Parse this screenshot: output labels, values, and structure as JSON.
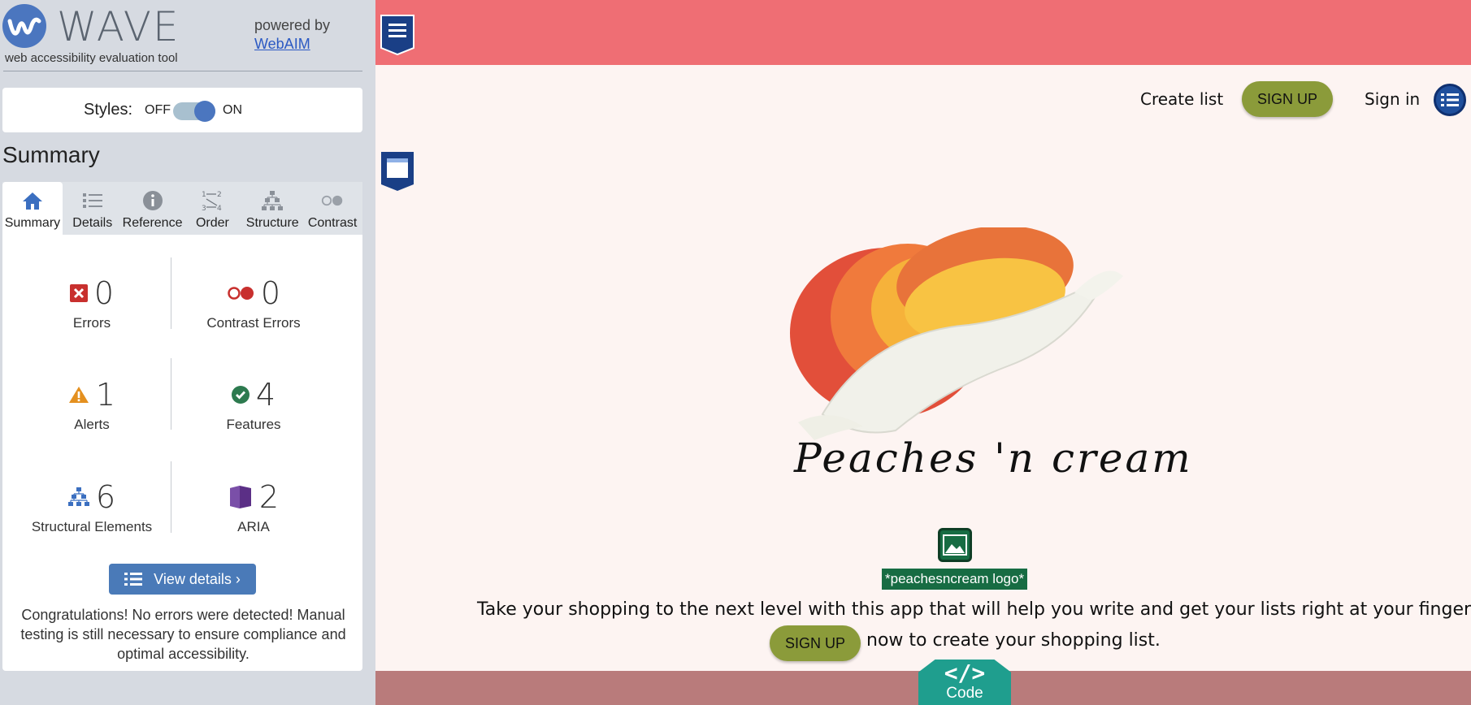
{
  "wave": {
    "brand": "WAVE",
    "tagline": "web accessibility evaluation tool",
    "powered_by": "powered by",
    "webaim_link": "WebAIM",
    "styles": {
      "label": "Styles:",
      "off": "OFF",
      "on": "ON",
      "state": "on"
    },
    "summary_heading": "Summary",
    "tabs": [
      {
        "label": "Summary",
        "icon": "home-icon",
        "active": true
      },
      {
        "label": "Details",
        "icon": "list-icon"
      },
      {
        "label": "Reference",
        "icon": "info-icon"
      },
      {
        "label": "Order",
        "icon": "order-icon"
      },
      {
        "label": "Structure",
        "icon": "structure-icon"
      },
      {
        "label": "Contrast",
        "icon": "contrast-icon"
      }
    ],
    "stats": {
      "errors": {
        "value": "0",
        "label": "Errors",
        "color": "#c8302e"
      },
      "contrast_errors": {
        "value": "0",
        "label": "Contrast Errors",
        "color": "#c8302e"
      },
      "alerts": {
        "value": "1",
        "label": "Alerts",
        "color": "#e4901f"
      },
      "features": {
        "value": "4",
        "label": "Features",
        "color": "#2d7a4f"
      },
      "structural": {
        "value": "6",
        "label": "Structural Elements",
        "color": "#3b6fc0"
      },
      "aria": {
        "value": "2",
        "label": "ARIA",
        "color": "#5b2f86"
      }
    },
    "view_details": "View details ›",
    "congrats": "Congratulations! No errors were detected! Manual testing is still necessary to ensure compliance and optimal accessibility."
  },
  "page": {
    "nav": {
      "create_list": "Create list",
      "signup": "SIGN UP",
      "signin": "Sign in"
    },
    "logo_script": "Peaches 'n cream",
    "alt_badge": "*peachesncream logo*",
    "tagline": "Take your shopping to the next level with this app that will help you write and get your lists right at your finger tips.",
    "signup_inline": "SIGN UP",
    "now_text": "now to create your shopping list.",
    "code_tab": {
      "glyph": "</>",
      "label": "Code"
    },
    "colors": {
      "topbar": "#ef6e74",
      "background": "#fdf4f2",
      "pill": "#8b9b3a",
      "footer": "#b97b7b",
      "code_tab": "#1f9e8e"
    }
  }
}
